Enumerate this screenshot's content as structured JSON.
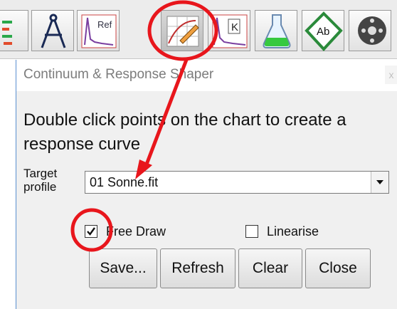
{
  "toolbar": {
    "items": [
      {
        "icon": "list-settings-icon"
      },
      {
        "icon": "compass-icon"
      },
      {
        "icon": "reference-spectrum-icon",
        "text": "Ref"
      },
      {
        "icon": "response-shaper-icon"
      },
      {
        "icon": "k-spectrum-icon",
        "text": "K"
      },
      {
        "icon": "flask-icon"
      },
      {
        "icon": "abbreviation-icon",
        "text": "Ab"
      },
      {
        "icon": "film-reel-icon"
      }
    ]
  },
  "dialog": {
    "title": "Continuum & Response Shaper",
    "close_label": "x",
    "instructions": "Double click points on the chart to create a response curve",
    "target_label": "Target profile",
    "target_value": "01 Sonne.fit",
    "free_draw_label": "Free Draw",
    "free_draw_checked": true,
    "linearise_label": "Linearise",
    "linearise_checked": false,
    "buttons": {
      "save": "Save...",
      "refresh": "Refresh",
      "clear": "Clear",
      "close": "Close"
    }
  },
  "colors": {
    "annotation": "#e8161c",
    "dialog_bg": "#f0f0f0",
    "window_border": "#5a8fd0"
  }
}
